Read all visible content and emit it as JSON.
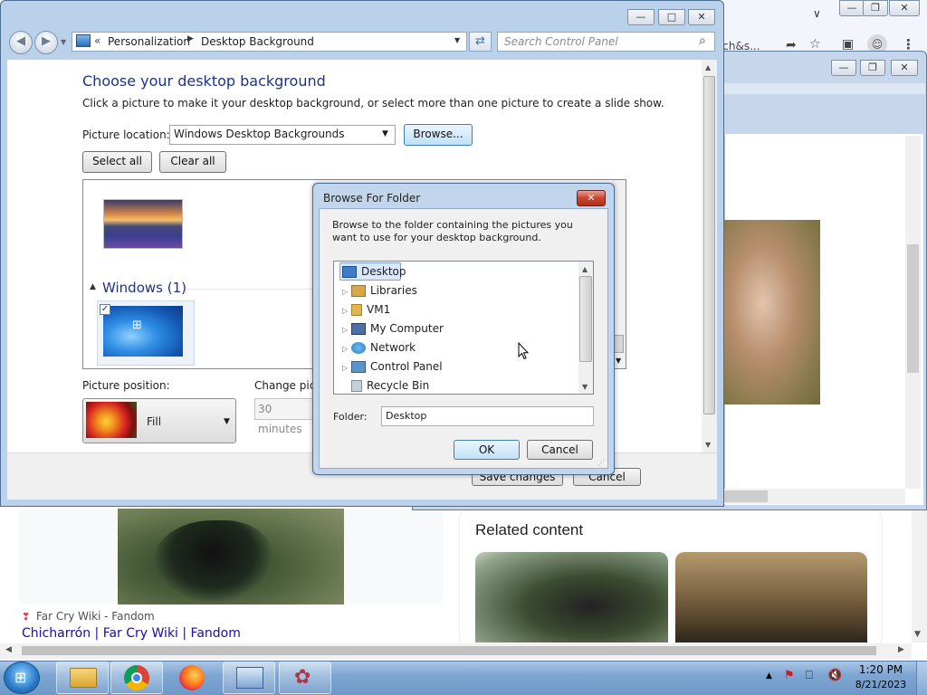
{
  "chrome": {
    "omnibox_partial": "sch&s...",
    "related_title": "Related content",
    "result": {
      "source": "Far Cry Wiki - Fandom",
      "title": "Chicharrón | Far Cry Wiki | Fandom"
    }
  },
  "control_panel": {
    "breadcrumb": [
      "Personalization",
      "Desktop Background"
    ],
    "search_placeholder": "Search Control Panel",
    "heading": "Choose your desktop background",
    "subheading": "Click a picture to make it your desktop background, or select more than one picture to create a slide show.",
    "picture_location_label": "Picture location:",
    "picture_location_value": "Windows Desktop Backgrounds",
    "browse_label": "Browse...",
    "select_all_label": "Select all",
    "clear_all_label": "Clear all",
    "group_label": "Windows (1)",
    "picture_position_label": "Picture position:",
    "picture_position_value": "Fill",
    "change_picture_label": "Change pict",
    "change_interval_value": "30 minutes",
    "save_label": "Save changes",
    "cancel_label": "Cancel"
  },
  "dialog": {
    "title": "Browse For Folder",
    "close_glyph": "✕",
    "description": "Browse to the folder containing the pictures you want to use for your desktop background.",
    "tree_items": [
      {
        "label": "Desktop",
        "icon": "desktop-icon",
        "color": "#3d7cc9"
      },
      {
        "label": "Libraries",
        "icon": "libraries-icon",
        "color": "#d6a84a"
      },
      {
        "label": "VM1",
        "icon": "user-folder-icon",
        "color": "#e0b655"
      },
      {
        "label": "My Computer",
        "icon": "computer-icon",
        "color": "#4c6fa8"
      },
      {
        "label": "Network",
        "icon": "network-icon",
        "color": "#2e7fc4"
      },
      {
        "label": "Control Panel",
        "icon": "control-panel-icon",
        "color": "#5b95c9"
      },
      {
        "label": "Recycle Bin",
        "icon": "recycle-bin-icon",
        "color": "#9aa9b8"
      }
    ],
    "folder_label": "Folder:",
    "folder_value": "Desktop",
    "ok_label": "OK",
    "cancel_label": "Cancel"
  },
  "taskbar": {
    "time": "1:20 PM",
    "date": "8/21/2023"
  }
}
